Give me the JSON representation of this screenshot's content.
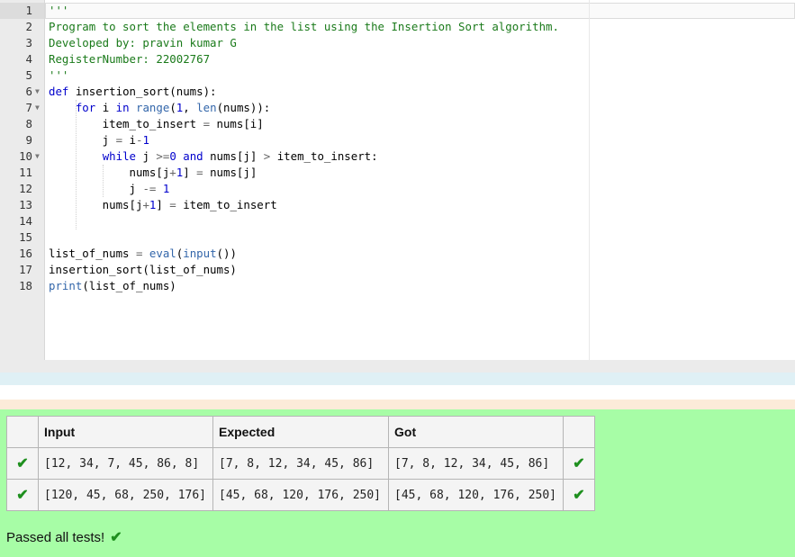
{
  "editor": {
    "lines": [
      {
        "no": "1",
        "fold": false,
        "tokens": [
          [
            "s",
            "'''"
          ]
        ]
      },
      {
        "no": "2",
        "fold": false,
        "tokens": [
          [
            "s",
            "Program to sort the elements in the list using the Insertion Sort algorithm."
          ]
        ]
      },
      {
        "no": "3",
        "fold": false,
        "tokens": [
          [
            "s",
            "Developed by: pravin kumar G"
          ]
        ]
      },
      {
        "no": "4",
        "fold": false,
        "tokens": [
          [
            "s",
            "RegisterNumber: 22002767"
          ]
        ]
      },
      {
        "no": "5",
        "fold": false,
        "tokens": [
          [
            "s",
            "'''"
          ]
        ]
      },
      {
        "no": "6",
        "fold": true,
        "tokens": [
          [
            "k",
            "def"
          ],
          [
            "",
            "",
            " "
          ],
          [
            "",
            "insertion_sort(nums):"
          ]
        ]
      },
      {
        "no": "7",
        "fold": true,
        "tokens": [
          [
            "",
            "    "
          ],
          [
            "k",
            "for"
          ],
          [
            "",
            " i "
          ],
          [
            "k",
            "in"
          ],
          [
            "",
            " "
          ],
          [
            "b",
            "range"
          ],
          [
            "",
            "("
          ],
          [
            "n",
            "1"
          ],
          [
            "",
            ", "
          ],
          [
            "b",
            "len"
          ],
          [
            "",
            "(nums)):"
          ]
        ]
      },
      {
        "no": "8",
        "fold": false,
        "tokens": [
          [
            "",
            "        item_to_insert "
          ],
          [
            "o",
            "="
          ],
          [
            "",
            " nums[i]"
          ]
        ]
      },
      {
        "no": "9",
        "fold": false,
        "tokens": [
          [
            "",
            "        j "
          ],
          [
            "o",
            "="
          ],
          [
            "",
            " i"
          ],
          [
            "o",
            "-"
          ],
          [
            "n",
            "1"
          ]
        ]
      },
      {
        "no": "10",
        "fold": true,
        "tokens": [
          [
            "",
            "        "
          ],
          [
            "k",
            "while"
          ],
          [
            "",
            " j "
          ],
          [
            "o",
            ">="
          ],
          [
            "n",
            "0"
          ],
          [
            "",
            " "
          ],
          [
            "k",
            "and"
          ],
          [
            "",
            " nums[j] "
          ],
          [
            "o",
            ">"
          ],
          [
            "",
            " item_to_insert:"
          ]
        ]
      },
      {
        "no": "11",
        "fold": false,
        "tokens": [
          [
            "",
            "            nums[j"
          ],
          [
            "o",
            "+"
          ],
          [
            "n",
            "1"
          ],
          [
            "",
            "] "
          ],
          [
            "o",
            "="
          ],
          [
            "",
            " nums[j]"
          ]
        ]
      },
      {
        "no": "12",
        "fold": false,
        "tokens": [
          [
            "",
            "            j "
          ],
          [
            "o",
            "-="
          ],
          [
            "",
            " "
          ],
          [
            "n",
            "1"
          ]
        ]
      },
      {
        "no": "13",
        "fold": false,
        "tokens": [
          [
            "",
            "        nums[j"
          ],
          [
            "o",
            "+"
          ],
          [
            "n",
            "1"
          ],
          [
            "",
            "] "
          ],
          [
            "o",
            "="
          ],
          [
            "",
            " item_to_insert"
          ]
        ]
      },
      {
        "no": "14",
        "fold": false,
        "tokens": []
      },
      {
        "no": "15",
        "fold": false,
        "tokens": []
      },
      {
        "no": "16",
        "fold": false,
        "tokens": [
          [
            "",
            "list_of_nums "
          ],
          [
            "o",
            "="
          ],
          [
            "",
            " "
          ],
          [
            "b",
            "eval"
          ],
          [
            "",
            "("
          ],
          [
            "b",
            "input"
          ],
          [
            "",
            "())"
          ]
        ]
      },
      {
        "no": "17",
        "fold": false,
        "tokens": [
          [
            "",
            "insertion_sort(list_of_nums)"
          ]
        ]
      },
      {
        "no": "18",
        "fold": false,
        "tokens": [
          [
            "b",
            "print"
          ],
          [
            "",
            "(list_of_nums)"
          ]
        ]
      }
    ]
  },
  "results": {
    "headers": {
      "input": "Input",
      "expected": "Expected",
      "got": "Got"
    },
    "rows": [
      {
        "input": "[12, 34, 7, 45, 86, 8]",
        "expected": "[7, 8, 12, 34, 45, 86]",
        "got": "[7, 8, 12, 34, 45, 86]",
        "status": "pass"
      },
      {
        "input": "[120, 45, 68, 250, 176]",
        "expected": "[45, 68, 120, 176, 250]",
        "got": "[45, 68, 120, 176, 250]",
        "status": "pass"
      }
    ],
    "summary": "Passed all tests!",
    "icon": "check-icon"
  },
  "colors": {
    "pass_bg": "#a7fda6",
    "tick": "#1e8f1e",
    "string": "#1a7a1a",
    "keyword": "#0000cc"
  }
}
